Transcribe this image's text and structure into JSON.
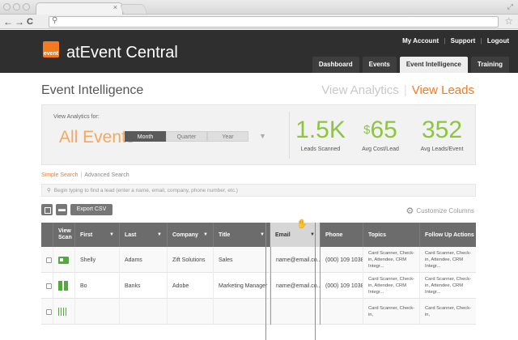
{
  "header": {
    "app_title": "atEvent Central",
    "logo_text": "event",
    "top_links": [
      "My Account",
      "Support",
      "Logout"
    ],
    "tabs": [
      {
        "label": "Dashboard",
        "active": false
      },
      {
        "label": "Events",
        "active": false
      },
      {
        "label": "Event Intelligence",
        "active": true
      },
      {
        "label": "Training",
        "active": false
      }
    ]
  },
  "page": {
    "title": "Event Intelligence",
    "view_analytics": "View Analytics",
    "view_leads": "View Leads"
  },
  "stats": {
    "view_label": "View Analytics for:",
    "scope": "All Events",
    "periods": [
      "Month",
      "Quarter",
      "Year"
    ],
    "active_period": "Month",
    "items": [
      {
        "value": "1.5K",
        "label": "Leads Scanned"
      },
      {
        "value": "65",
        "prefix": "$",
        "label": "Avg Cost/Lead"
      },
      {
        "value": "352",
        "label": "Avg Leads/Event"
      }
    ]
  },
  "search": {
    "simple": "Simple Search",
    "advanced": "Advanced Search",
    "placeholder": "Begin typing to find a lead (enter a name, email, company, phone number, etc.)"
  },
  "toolbar": {
    "export_label": "Export CSV",
    "customize_label": "Customize Columns"
  },
  "table": {
    "columns": [
      "",
      "View Scan",
      "First",
      "Last",
      "Company",
      "Title",
      "Email",
      "Phone",
      "Topics",
      "Follow Up Actions"
    ],
    "rows": [
      {
        "scan": "card",
        "first": "Shelly",
        "last": "Adams",
        "company": "Zift Solutions",
        "title": "Sales",
        "email": "name@email.co...",
        "phone": "(000) 109 1038",
        "topics": "Card Scanner, Check-in, Attendee, CRM Integr...",
        "followup": "Card Scanner, Check-in, Attendee, CRM Integr..."
      },
      {
        "scan": "qr",
        "first": "Bo",
        "last": "Banks",
        "company": "Adobe",
        "title": "Marketing Manager",
        "email": "name@email.co...",
        "phone": "(000) 109 1038",
        "topics": "Card Scanner, Check-in, Attendee, CRM Integr...",
        "followup": "Card Scanner, Check-in, Attendee, CRM Integr..."
      },
      {
        "scan": "bar",
        "first": "",
        "last": "",
        "company": "",
        "title": "",
        "email": "",
        "phone": "",
        "topics": "Card Scanner, Check-in,",
        "followup": "Card Scanner, Check-in,"
      }
    ]
  }
}
